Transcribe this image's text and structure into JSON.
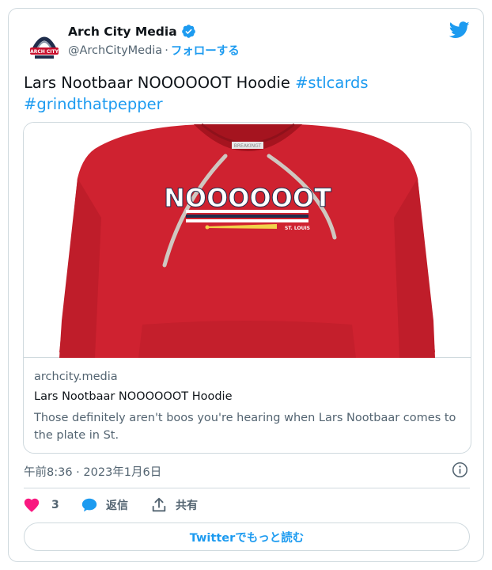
{
  "author": {
    "display_name": "Arch City Media",
    "handle": "@ArchCityMedia",
    "separator": "·",
    "follow_label": "フォローする",
    "avatar_text": "ARCH CITY"
  },
  "tweet": {
    "text": "Lars Nootbaar NOOOOOOT Hoodie",
    "hashtags": [
      "#stlcards",
      "#grindthatpepper"
    ]
  },
  "card": {
    "image": {
      "print_text": "NOOOOOOT",
      "city_text": "ST. LOUIS",
      "hood_tag_text": "BREAKINGT",
      "colors": {
        "hoodie": "#cf2230",
        "stripe_white": "#ffffff",
        "stripe_navy": "#1f2d4c",
        "bat": "#f2d24a"
      }
    },
    "domain": "archcity.media",
    "title": "Lars Nootbaar NOOOOOOT Hoodie",
    "description": "Those definitely aren't boos you're hearing when Lars Nootbaar comes to the plate in St."
  },
  "timestamp": "午前8:36 · 2023年1月6日",
  "actions": {
    "like_count": "3",
    "reply_label": "返信",
    "share_label": "共有"
  },
  "read_more_label": "Twitterでもっと読む",
  "icons": {
    "verified": "verified-badge-icon",
    "brand": "twitter-bird-icon",
    "info": "info-icon",
    "like": "heart-icon",
    "reply": "speech-bubble-icon",
    "share": "share-icon"
  },
  "colors": {
    "accent": "#1d9bf0",
    "like": "#f91880",
    "secondary_text": "#536471",
    "border": "#cfd9de"
  }
}
